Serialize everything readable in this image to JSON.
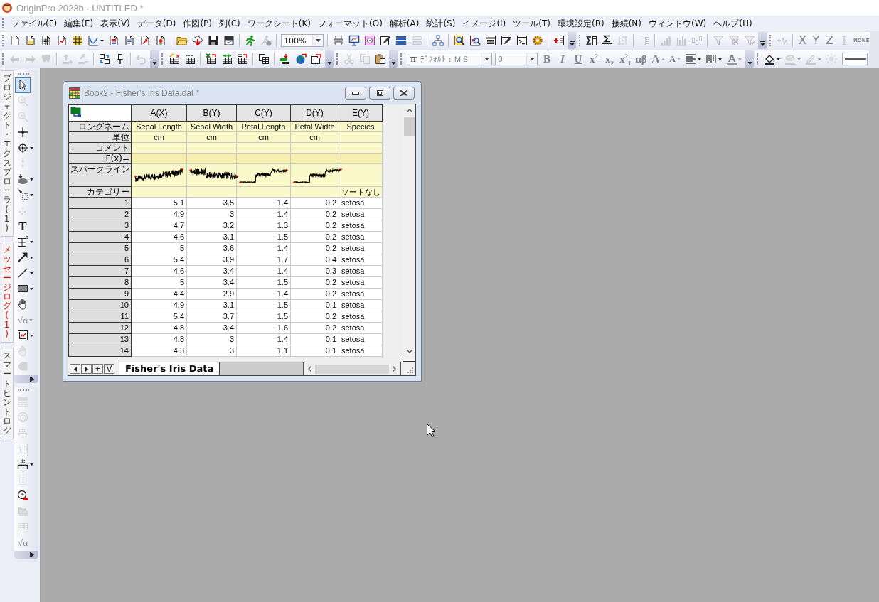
{
  "app": {
    "title": "OriginPro 2023b - UNTITLED *"
  },
  "menu": [
    "ファイル(F)",
    "編集(E)",
    "表示(V)",
    "データ(D)",
    "作図(P)",
    "列(C)",
    "ワークシート(K)",
    "フォーマット(O)",
    "解析(A)",
    "統計(S)",
    "イメージ(I)",
    "ツール(T)",
    "環境設定(R)",
    "接続(N)",
    "ウィンドウ(W)",
    "ヘルプ(H)"
  ],
  "toolbar_rows": [
    [
      {
        "items": [
          {
            "kind": "button",
            "disabled": false
          },
          {
            "kind": "button",
            "disabled": false
          },
          {
            "kind": "button",
            "disabled": false
          },
          {
            "kind": "button",
            "disabled": false
          },
          {
            "kind": "button",
            "disabled": false
          },
          {
            "kind": "split",
            "disabled": false
          },
          {
            "kind": "button",
            "disabled": false
          },
          {
            "kind": "button",
            "disabled": false
          },
          {
            "kind": "button",
            "disabled": false
          },
          {
            "kind": "button",
            "disabled": false
          },
          {
            "kind": "separator"
          },
          {
            "kind": "button",
            "disabled": false
          },
          {
            "kind": "button",
            "disabled": false
          },
          {
            "kind": "button",
            "disabled": false
          },
          {
            "kind": "button",
            "disabled": false
          },
          {
            "kind": "separator"
          },
          {
            "kind": "button",
            "disabled": false
          },
          {
            "kind": "button",
            "disabled": true
          },
          {
            "kind": "separator"
          },
          {
            "kind": "combo",
            "value": "100%",
            "disabled": false
          },
          {
            "kind": "separator"
          },
          {
            "kind": "button",
            "disabled": false
          },
          {
            "kind": "button",
            "disabled": false
          },
          {
            "kind": "button",
            "disabled": false
          },
          {
            "kind": "button",
            "disabled": false
          },
          {
            "kind": "button",
            "disabled": false
          },
          {
            "kind": "button",
            "disabled": true
          },
          {
            "kind": "separator"
          },
          {
            "kind": "button",
            "disabled": false
          },
          {
            "kind": "separator"
          },
          {
            "kind": "button",
            "disabled": false
          },
          {
            "kind": "button",
            "disabled": false
          },
          {
            "kind": "button",
            "disabled": false
          },
          {
            "kind": "button",
            "disabled": false
          },
          {
            "kind": "button",
            "disabled": false
          },
          {
            "kind": "button",
            "disabled": false
          },
          {
            "kind": "separator"
          },
          {
            "kind": "button",
            "disabled": false
          },
          {
            "kind": "overflow"
          }
        ]
      },
      {
        "items": [
          {
            "kind": "button",
            "disabled": false
          },
          {
            "kind": "button",
            "disabled": false
          },
          {
            "kind": "button",
            "disabled": true
          },
          {
            "kind": "separator"
          },
          {
            "kind": "button",
            "disabled": true
          },
          {
            "kind": "separator"
          },
          {
            "kind": "button",
            "disabled": true
          },
          {
            "kind": "button",
            "disabled": true
          },
          {
            "kind": "button",
            "disabled": true
          },
          {
            "kind": "separator"
          },
          {
            "kind": "button",
            "disabled": true
          },
          {
            "kind": "button",
            "disabled": true
          },
          {
            "kind": "button",
            "disabled": true
          },
          {
            "kind": "overflow"
          }
        ]
      },
      {
        "items": [
          {
            "kind": "button",
            "disabled": true
          },
          {
            "kind": "separator"
          },
          {
            "kind": "button",
            "label": "X",
            "disabled": true
          },
          {
            "kind": "button",
            "label": "Y",
            "disabled": true
          },
          {
            "kind": "button",
            "label": "Z",
            "disabled": true
          },
          {
            "kind": "button",
            "disabled": true
          },
          {
            "kind": "button",
            "label": "NONE",
            "disabled": true
          }
        ]
      }
    ],
    [
      {
        "items": [
          {
            "kind": "button",
            "disabled": true
          },
          {
            "kind": "button",
            "disabled": true
          },
          {
            "kind": "button",
            "disabled": true
          },
          {
            "kind": "separator"
          },
          {
            "kind": "button",
            "disabled": true
          },
          {
            "kind": "button",
            "disabled": true
          },
          {
            "kind": "separator"
          },
          {
            "kind": "button",
            "disabled": false
          },
          {
            "kind": "button",
            "disabled": false
          },
          {
            "kind": "separator"
          },
          {
            "kind": "button",
            "disabled": true
          },
          {
            "kind": "overflow"
          }
        ]
      },
      {
        "items": [
          {
            "kind": "button",
            "disabled": false
          },
          {
            "kind": "button",
            "disabled": false
          },
          {
            "kind": "separator"
          },
          {
            "kind": "button",
            "disabled": false
          },
          {
            "kind": "button",
            "disabled": false
          },
          {
            "kind": "button",
            "disabled": false
          },
          {
            "kind": "separator"
          },
          {
            "kind": "button",
            "disabled": false
          },
          {
            "kind": "separator"
          },
          {
            "kind": "button",
            "disabled": false
          },
          {
            "kind": "button",
            "disabled": false
          },
          {
            "kind": "button",
            "disabled": false
          },
          {
            "kind": "overflow"
          }
        ]
      },
      {
        "items": [
          {
            "kind": "button",
            "disabled": true
          },
          {
            "kind": "button",
            "disabled": true
          },
          {
            "kind": "button",
            "disabled": false
          },
          {
            "kind": "overflow"
          }
        ]
      },
      {
        "items": [
          {
            "kind": "combo",
            "prefix": "TT",
            "value": "ﾃﾞﾌｫﾙﾄ : ＭＳ",
            "disabled": true
          },
          {
            "kind": "combo",
            "value": "0",
            "disabled": true
          },
          {
            "kind": "button",
            "label": "B",
            "disabled": true
          },
          {
            "kind": "button",
            "label": "I",
            "disabled": true
          },
          {
            "kind": "button",
            "label": "U",
            "disabled": true
          },
          {
            "kind": "button",
            "label": "x$^{2}$",
            "disabled": true
          },
          {
            "kind": "button",
            "label": "x$_{2}$",
            "disabled": true
          },
          {
            "kind": "button",
            "label": "x$^{2}$$_{1}$",
            "disabled": true
          },
          {
            "kind": "button",
            "label": "αβ",
            "disabled": true
          },
          {
            "kind": "button",
            "label": "A",
            "disabled": true
          },
          {
            "kind": "button",
            "label": "A",
            "disabled": true
          },
          {
            "kind": "split",
            "disabled": false
          },
          {
            "kind": "split",
            "disabled": false
          },
          {
            "kind": "split",
            "label": "A",
            "disabled": true
          },
          {
            "kind": "overflow"
          }
        ]
      },
      {
        "items": [
          {
            "kind": "split",
            "disabled": false
          },
          {
            "kind": "split",
            "disabled": true
          },
          {
            "kind": "split",
            "disabled": true
          },
          {
            "kind": "button",
            "disabled": true
          },
          {
            "kind": "line_style"
          }
        ]
      }
    ]
  ],
  "dock_tabs": [
    {
      "label": "プロジェクト・エクスプローラ (1)",
      "selected": false,
      "unread": false
    },
    {
      "label": "メッセージログ (1)",
      "selected": false,
      "unread": true
    },
    {
      "label": "スマートヒントログ",
      "selected": false,
      "unread": false
    }
  ],
  "tool_palettes": [
    {
      "items": [
        {
          "kind": "button",
          "selected": true,
          "disabled": false
        },
        {
          "kind": "button",
          "selected": false,
          "disabled": true
        },
        {
          "kind": "button",
          "selected": false,
          "disabled": true
        },
        {
          "kind": "button",
          "selected": false,
          "disabled": false
        },
        {
          "kind": "split",
          "selected": false,
          "disabled": false
        },
        {
          "kind": "button",
          "selected": false,
          "disabled": true
        },
        {
          "kind": "split",
          "selected": false,
          "disabled": false
        },
        {
          "kind": "split",
          "selected": false,
          "disabled": false
        },
        {
          "kind": "button",
          "selected": false,
          "disabled": true
        },
        {
          "kind": "button",
          "label": "T",
          "selected": false,
          "disabled": false
        },
        {
          "kind": "split",
          "selected": false,
          "disabled": false
        },
        {
          "kind": "split",
          "selected": false,
          "disabled": false
        },
        {
          "kind": "split",
          "selected": false,
          "disabled": false
        },
        {
          "kind": "split",
          "selected": false,
          "disabled": false
        },
        {
          "kind": "button",
          "selected": false,
          "disabled": false
        },
        {
          "kind": "split",
          "label": "√α",
          "selected": false,
          "disabled": true
        },
        {
          "kind": "split",
          "selected": false,
          "disabled": false
        },
        {
          "kind": "button",
          "selected": false,
          "disabled": true
        },
        {
          "kind": "button",
          "selected": false,
          "disabled": true
        },
        {
          "kind": "overflow"
        }
      ]
    },
    {
      "items": [
        {
          "kind": "button",
          "disabled": true
        },
        {
          "kind": "button",
          "disabled": true
        },
        {
          "kind": "button",
          "disabled": true
        },
        {
          "kind": "button",
          "disabled": true
        },
        {
          "kind": "split",
          "disabled": false
        },
        {
          "kind": "button",
          "disabled": true
        },
        {
          "kind": "button",
          "disabled": false
        },
        {
          "kind": "button",
          "disabled": true
        },
        {
          "kind": "button",
          "disabled": true
        },
        {
          "kind": "button",
          "label": "√α",
          "disabled": true
        },
        {
          "kind": "overflow"
        }
      ]
    }
  ],
  "workbook": {
    "title": "Book2 - Fisher's Iris Data.dat *",
    "columns": [
      {
        "header": "A(X)",
        "kind": "numeric",
        "long_name": "Sepal Length",
        "units": "cm",
        "sparkline": true
      },
      {
        "header": "B(Y)",
        "kind": "numeric",
        "long_name": "Sepal Width",
        "units": "cm",
        "sparkline": true
      },
      {
        "header": "C(Y)",
        "kind": "numeric",
        "long_name": "Petal Length",
        "units": "cm",
        "sparkline": true
      },
      {
        "header": "D(Y)",
        "kind": "numeric",
        "long_name": "Petal Width",
        "units": "cm",
        "sparkline": true
      },
      {
        "header": "E(Y)",
        "kind": "text",
        "long_name": "Species",
        "sparkline": false,
        "categories": "ソートなし"
      }
    ],
    "label_rows": [
      {
        "label": "ロングネーム",
        "kind": "long_name"
      },
      {
        "label": "単位",
        "kind": "units"
      },
      {
        "label": "コメント",
        "kind": "comments"
      },
      {
        "label": "F(x)=",
        "kind": "formula"
      },
      {
        "label": "スパークライン",
        "kind": "sparkline"
      },
      {
        "label": "カテゴリー",
        "kind": "categories"
      }
    ],
    "rows": [
      {
        "row_number": "1",
        "values": [
          "5.1",
          "3.5",
          "1.4",
          "0.2",
          "setosa"
        ]
      },
      {
        "row_number": "2",
        "values": [
          "4.9",
          "3",
          "1.4",
          "0.2",
          "setosa"
        ]
      },
      {
        "row_number": "3",
        "values": [
          "4.7",
          "3.2",
          "1.3",
          "0.2",
          "setosa"
        ]
      },
      {
        "row_number": "4",
        "values": [
          "4.6",
          "3.1",
          "1.5",
          "0.2",
          "setosa"
        ]
      },
      {
        "row_number": "5",
        "values": [
          "5",
          "3.6",
          "1.4",
          "0.2",
          "setosa"
        ]
      },
      {
        "row_number": "6",
        "values": [
          "5.4",
          "3.9",
          "1.7",
          "0.4",
          "setosa"
        ]
      },
      {
        "row_number": "7",
        "values": [
          "4.6",
          "3.4",
          "1.4",
          "0.3",
          "setosa"
        ]
      },
      {
        "row_number": "8",
        "values": [
          "5",
          "3.4",
          "1.5",
          "0.2",
          "setosa"
        ]
      },
      {
        "row_number": "9",
        "values": [
          "4.4",
          "2.9",
          "1.4",
          "0.2",
          "setosa"
        ]
      },
      {
        "row_number": "10",
        "values": [
          "4.9",
          "3.1",
          "1.5",
          "0.1",
          "setosa"
        ]
      },
      {
        "row_number": "11",
        "values": [
          "5.4",
          "3.7",
          "1.5",
          "0.2",
          "setosa"
        ]
      },
      {
        "row_number": "12",
        "values": [
          "4.8",
          "3.4",
          "1.6",
          "0.2",
          "setosa"
        ]
      },
      {
        "row_number": "13",
        "values": [
          "4.8",
          "3",
          "1.4",
          "0.1",
          "setosa"
        ]
      },
      {
        "row_number": "14",
        "values": [
          "4.3",
          "3",
          "1.1",
          "0.1",
          "setosa"
        ]
      }
    ],
    "sheet_nav": [
      {
        "kind": "previous"
      },
      {
        "kind": "next"
      },
      {
        "kind": "text",
        "label": "+"
      },
      {
        "kind": "text",
        "label": "V"
      }
    ],
    "sheets": [
      {
        "label": "Fisher's Iris Data",
        "selected": true
      }
    ]
  }
}
